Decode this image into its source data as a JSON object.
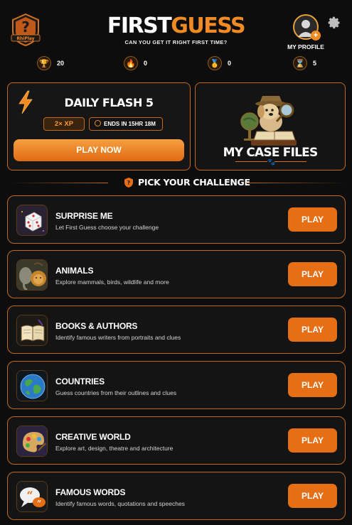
{
  "header": {
    "badge_text": "RhiPlay",
    "title_part1": "FIRST",
    "title_part2": "GUESS",
    "subtitle": "CAN YOU GET IT RIGHT FIRST TIME?",
    "profile_label": "MY PROFILE"
  },
  "stats": [
    {
      "icon": "trophy-icon",
      "value": "20"
    },
    {
      "icon": "flame-icon",
      "value": "0"
    },
    {
      "icon": "medal-icon",
      "value": "0"
    },
    {
      "icon": "hourglass-icon",
      "value": "5"
    }
  ],
  "daily": {
    "title": "DAILY FLASH 5",
    "xp_badge": "2× XP",
    "ends_text": "ENDS IN 15HR 18M",
    "button_label": "PLAY NOW"
  },
  "case_files": {
    "title": "MY CASE FILES"
  },
  "section": {
    "title": "PICK YOUR CHALLENGE"
  },
  "challenges": [
    {
      "title": "SURPRISE ME",
      "desc": "Let First Guess choose your challenge",
      "play": "PLAY",
      "icon": "dice-icon"
    },
    {
      "title": "ANIMALS",
      "desc": "Explore mammals, birds, wildlife and more",
      "play": "PLAY",
      "icon": "animals-icon"
    },
    {
      "title": "BOOKS & AUTHORS",
      "desc": "Identify famous writers from portraits and clues",
      "play": "PLAY",
      "icon": "book-icon"
    },
    {
      "title": "COUNTRIES",
      "desc": "Guess countries from their outlines and clues",
      "play": "PLAY",
      "icon": "globe-icon"
    },
    {
      "title": "CREATIVE WORLD",
      "desc": "Explore art, design, theatre and architecture",
      "play": "PLAY",
      "icon": "palette-icon"
    },
    {
      "title": "FAMOUS WORDS",
      "desc": "Identify famous words, quotations and speeches",
      "play": "PLAY",
      "icon": "speech-bubble-icon"
    }
  ],
  "colors": {
    "accent": "#f08a24",
    "border": "#c06a1c",
    "background": "#0d0d0d",
    "button": "#e66e14"
  }
}
